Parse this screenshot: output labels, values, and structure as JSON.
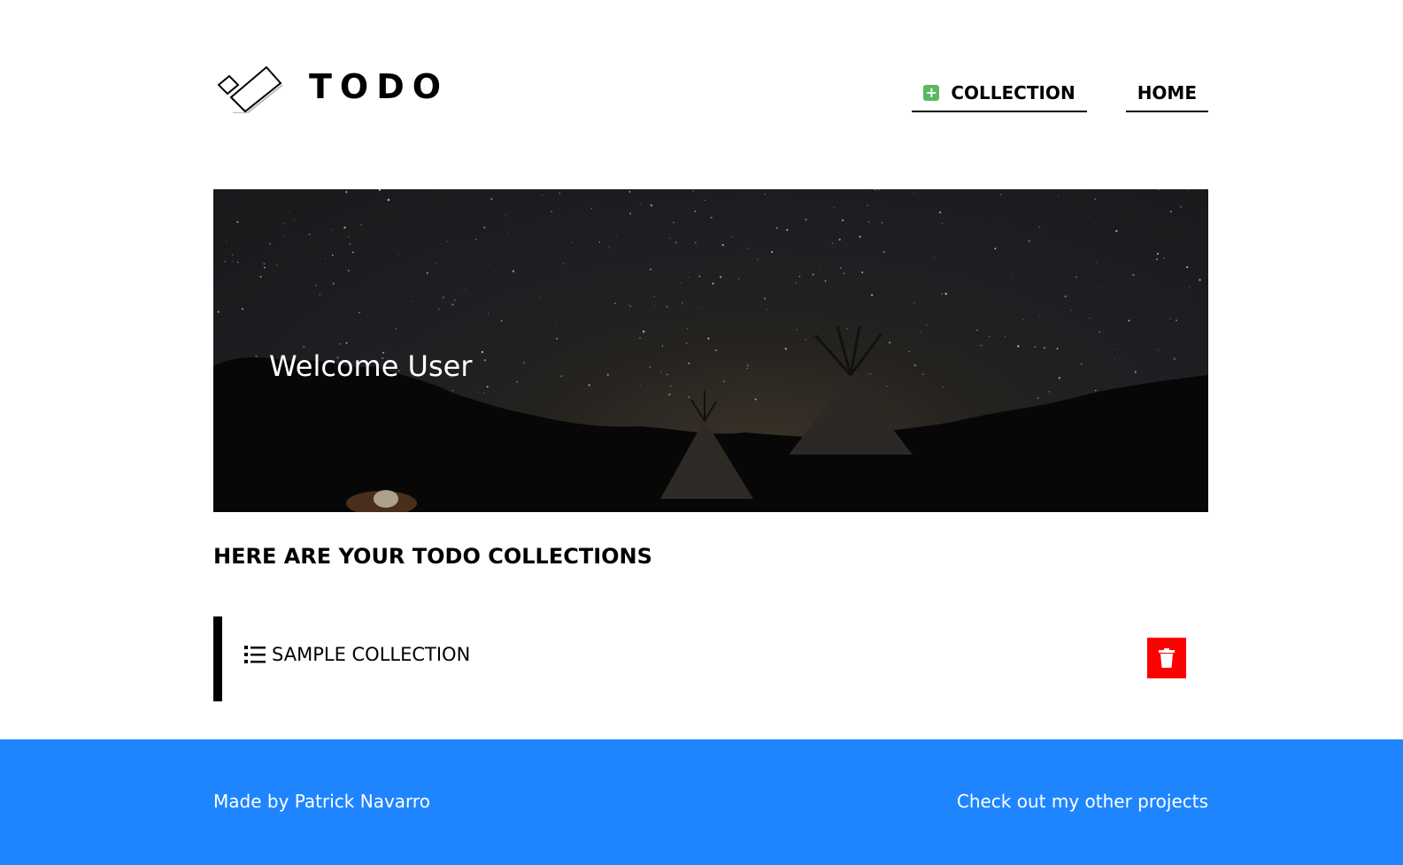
{
  "header": {
    "brand": "TODO",
    "nav": {
      "collection_label": "COLLECTION",
      "home_label": "HOME"
    }
  },
  "hero": {
    "welcome": "Welcome User"
  },
  "main": {
    "section_title": "HERE ARE YOUR TODO COLLECTIONS",
    "collections": [
      {
        "name": "SAMPLE COLLECTION"
      }
    ]
  },
  "footer": {
    "credit": "Made by Patrick Navarro",
    "projects_link": "Check out my other projects"
  },
  "colors": {
    "footer_bg": "#1e85ff",
    "delete_button": "#ff0000",
    "add_icon": "#5cb85c"
  },
  "icons": [
    "logo-mark",
    "plus-icon",
    "list-icon",
    "trash-icon"
  ]
}
